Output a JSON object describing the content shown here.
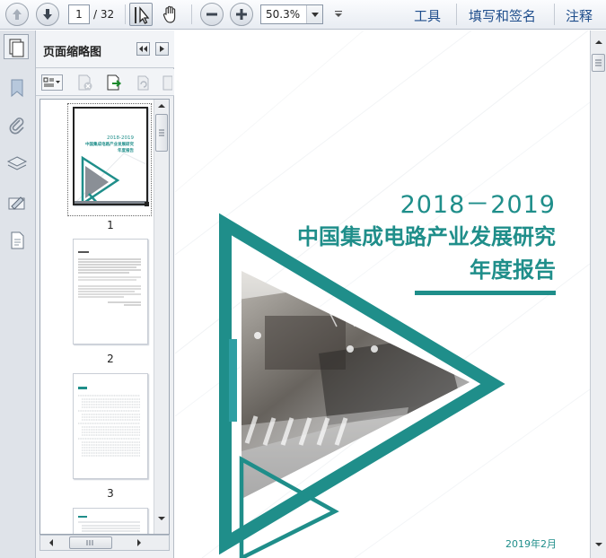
{
  "toolbar": {
    "page_current": "1",
    "page_total": "/ 32",
    "zoom_value": "50.3%",
    "menu_tools": "工具",
    "menu_sign": "填写和签名",
    "menu_comment": "注释"
  },
  "thumbnail_panel": {
    "title": "页面缩略图",
    "pages": [
      {
        "number": "1"
      },
      {
        "number": "2"
      },
      {
        "number": "3"
      }
    ]
  },
  "document": {
    "title_year": "2018－2019",
    "title_line2": "中国集成电路产业发展研究",
    "title_line3": "年度报告",
    "date": "2019年2月",
    "accent_color": "#1f8e8a"
  },
  "icons": [
    "arrow-up-icon",
    "arrow-down-icon",
    "select-tool-icon",
    "hand-tool-icon",
    "zoom-out-icon",
    "zoom-in-icon",
    "bookmark-icon",
    "attachment-icon",
    "layers-icon",
    "signature-icon",
    "page-icon"
  ]
}
